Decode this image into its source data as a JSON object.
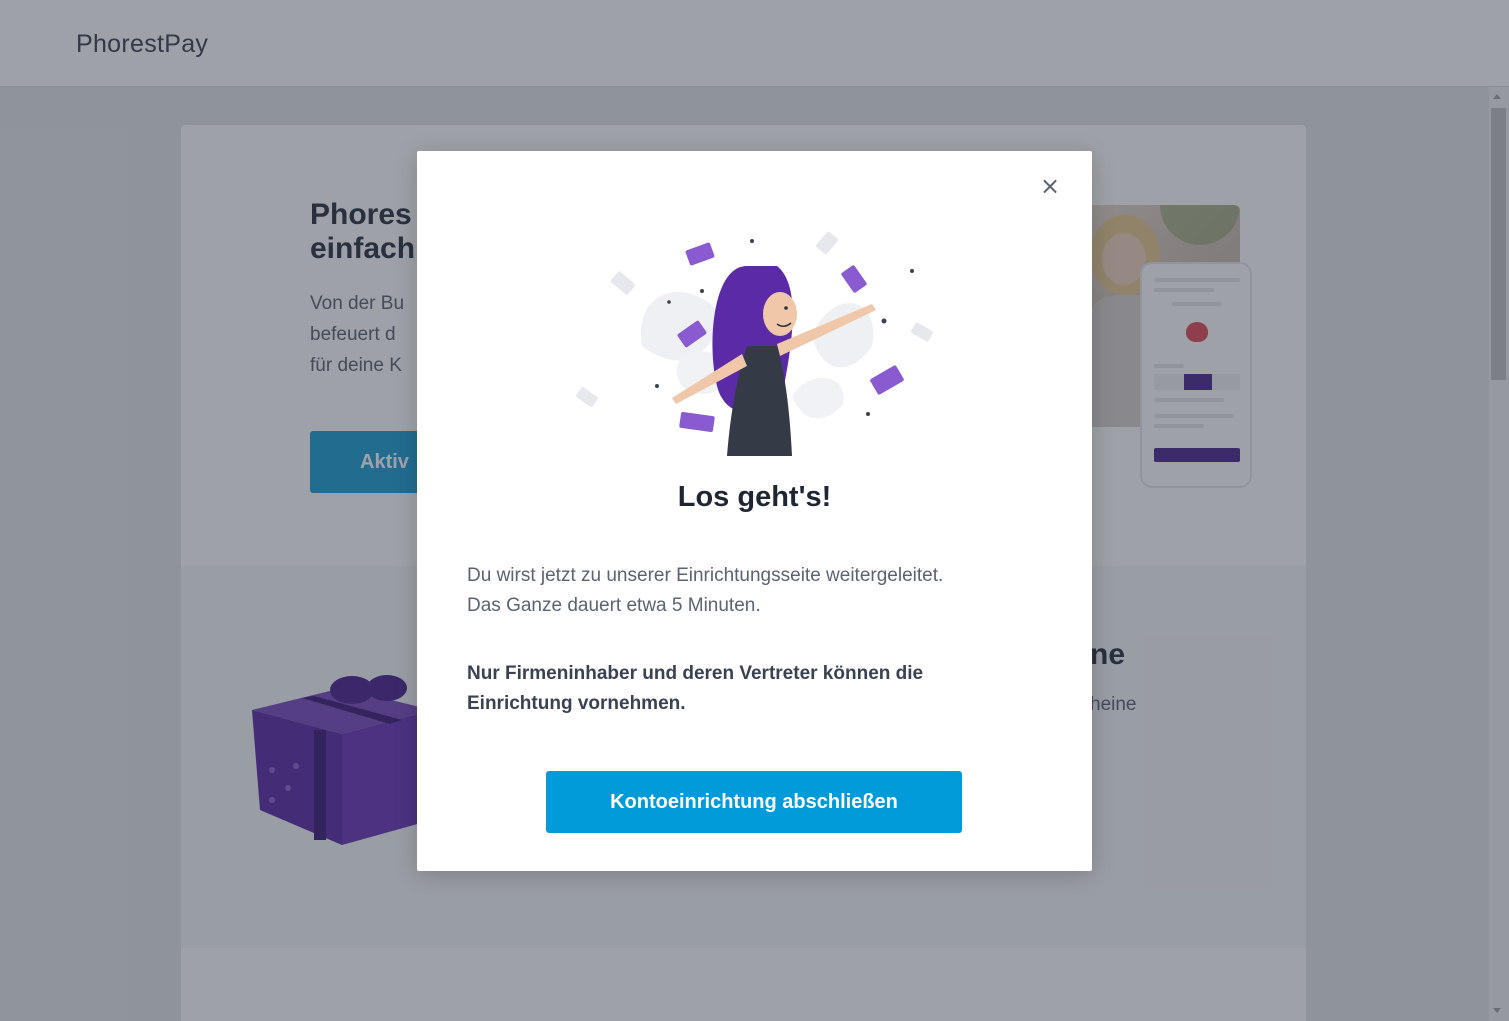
{
  "app": {
    "brand": "PhorestPay"
  },
  "background": {
    "hero": {
      "title_line1": "Phores",
      "title_line2": "einfach",
      "text_line1": "Von der Bu",
      "text_line2": "befeuert d",
      "text_line3": "für deine K",
      "button_label": "Aktiv"
    },
    "section2": {
      "title_fragment": "ne",
      "text_fragment": "heine"
    }
  },
  "modal": {
    "close_symbol": "×",
    "title": "Los geht's!",
    "text_line1": "Du wirst jetzt zu unserer Einrichtungsseite weitergeleitet.",
    "text_line2": "Das Ganze dauert etwa 5 Minuten.",
    "warning_line1": "Nur Firmeninhaber und deren Vertreter können die",
    "warning_line2": "Einrichtung vornehmen.",
    "primary_button": "Kontoeinrichtung abschließen"
  },
  "colors": {
    "accent": "#009bd8",
    "brand_purple": "#5b2aa6",
    "overlay": "rgba(40,46,60,0.45)"
  },
  "icons": [
    "close-icon",
    "celebration-illustration",
    "gift-illustration"
  ]
}
